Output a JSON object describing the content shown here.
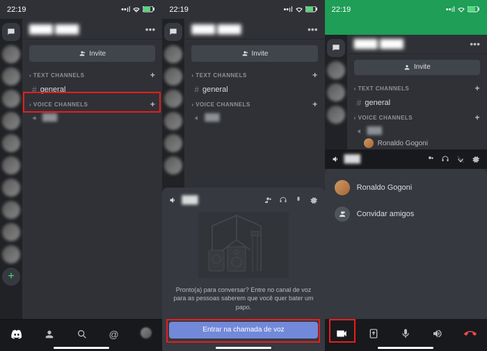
{
  "status": {
    "time": "22:19",
    "arrow": "↗"
  },
  "server": {
    "name": "████ ████",
    "menu": "•••"
  },
  "invite": {
    "label": "Invite"
  },
  "categories": {
    "text": {
      "label": "TEXT CHANNELS",
      "chevron": "›"
    },
    "voice": {
      "label": "VOICE CHANNELS",
      "chevron": "›"
    }
  },
  "channels": {
    "general": "general",
    "voice_name": "███"
  },
  "voice_user": {
    "name": "Ronaldo Gogoni"
  },
  "sheet": {
    "prompt": "Pronto(a) para conversar? Entre no canal de voz para as pessoas saberem que você quer bater um papo.",
    "join": "Entrar na chamada de voz"
  },
  "user_sheet": {
    "invite_friends": "Convidar amigos"
  },
  "icons": {
    "plus": "+",
    "hash": "#",
    "speaker": "🔊",
    "dm": "💬",
    "friends": "👥",
    "search": "🔍",
    "mentions": "@",
    "camera": "📹",
    "cast": "⇱",
    "mic": "🎤",
    "volume": "🔈",
    "hangup": "📞",
    "gear": "⚙",
    "headphones": "🎧",
    "mute": "🎙",
    "adduser": "👤+"
  }
}
